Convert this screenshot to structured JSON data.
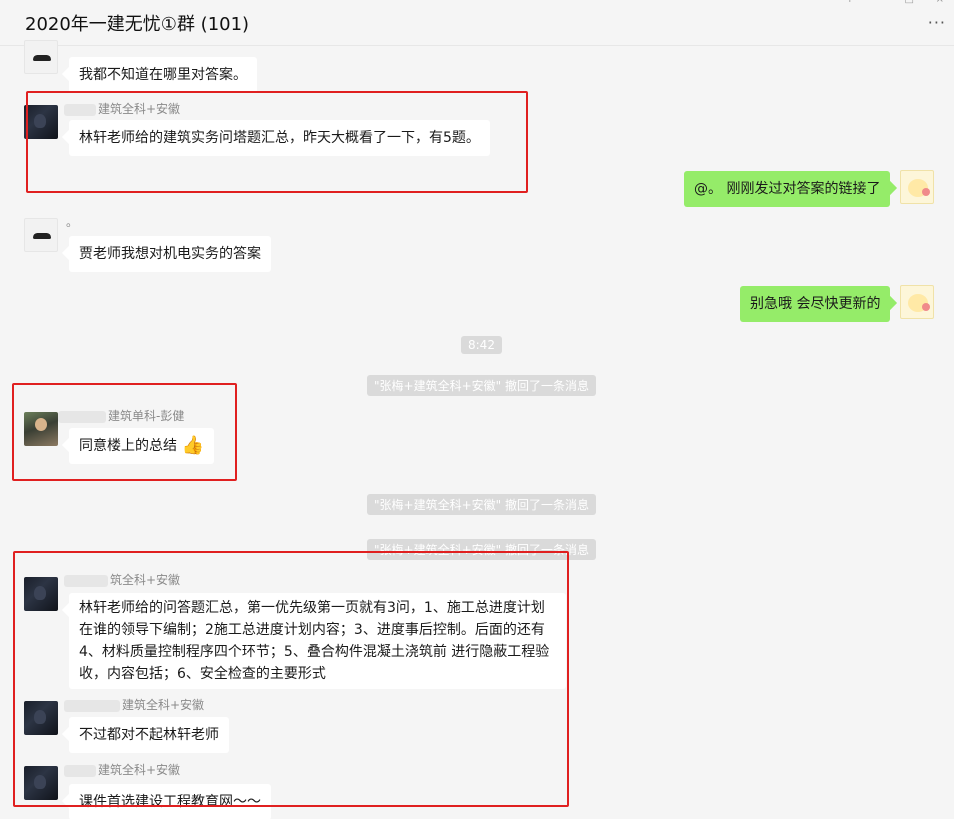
{
  "header": {
    "title": "2020年一建无忧①群 (101)",
    "more_icon": "···",
    "window_controls": [
      "+",
      "□",
      "×"
    ]
  },
  "messages": [
    {
      "sender": "",
      "text": "我都不知道在哪里对答案。"
    },
    {
      "sender": "建筑全科+安徽",
      "text": "林轩老师给的建筑实务问塔题汇总，昨天大概看了一下，有5题。"
    },
    {
      "sender": "",
      "text": "@。 刚刚发过对答案的链接了"
    },
    {
      "sender": "。",
      "text": "贾老师我想对机电实务的答案"
    },
    {
      "sender": "",
      "text": "别急哦 会尽快更新的"
    },
    {
      "sender": "建筑单科-彭健",
      "text": "同意楼上的总结",
      "emoji": "👍"
    },
    {
      "sender": "筑全科+安徽",
      "text": "林轩老师给的问答题汇总，第一优先级第一页就有3问，1、施工总进度计划在谁的领导下编制；2施工总进度计划内容；3、进度事后控制。后面的还有4、材料质量控制程序四个环节；5、叠合构件混凝土浇筑前 进行隐蔽工程验收，内容包括；6、安全检查的主要形式"
    },
    {
      "sender": "建筑全科+安徽",
      "text": "不过都对不起林轩老师"
    },
    {
      "sender": "建筑全科+安徽",
      "text": "课件首选建设工程教育网～～"
    }
  ],
  "system": {
    "time": "8:42",
    "recall_1": "\"张梅+建筑全科+安徽\" 撤回了一条消息",
    "recall_2": "\"张梅+建筑全科+安徽\" 撤回了一条消息",
    "recall_3": "\"张梅+建筑全科+安徽\" 撤回了一条消息"
  }
}
